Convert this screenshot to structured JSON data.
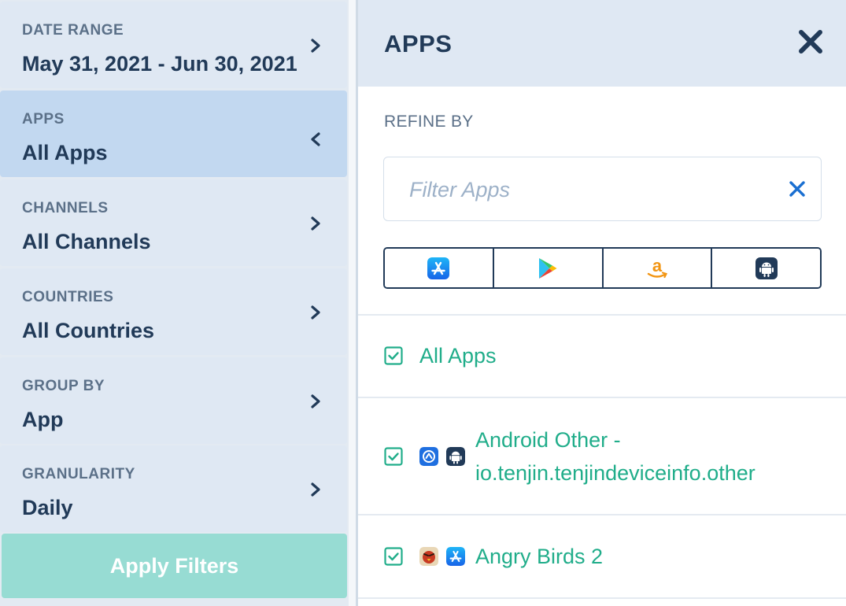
{
  "sidebar": {
    "filters": [
      {
        "label": "DATE RANGE",
        "value": "May 31, 2021 - Jun 30, 2021",
        "active": false
      },
      {
        "label": "APPS",
        "value": "All Apps",
        "active": true
      },
      {
        "label": "CHANNELS",
        "value": "All Channels",
        "active": false
      },
      {
        "label": "COUNTRIES",
        "value": "All Countries",
        "active": false
      },
      {
        "label": "GROUP BY",
        "value": "App",
        "active": false
      },
      {
        "label": "GRANULARITY",
        "value": "Daily",
        "active": false
      }
    ],
    "apply_label": "Apply Filters"
  },
  "panel": {
    "title": "APPS",
    "refine_label": "REFINE BY",
    "filter_placeholder": "Filter Apps",
    "filter_value": "",
    "stores": [
      {
        "name": "app-store",
        "icon": "app-store-icon"
      },
      {
        "name": "google-play",
        "icon": "google-play-icon"
      },
      {
        "name": "amazon",
        "icon": "amazon-icon"
      },
      {
        "name": "android",
        "icon": "android-icon"
      }
    ],
    "apps": [
      {
        "name": "All Apps",
        "checked": true,
        "icons": []
      },
      {
        "name_line1": "Android Other -",
        "name_line2": "io.tenjin.tenjindeviceinfo.other",
        "checked": true,
        "icons": [
          "app-generic-icon",
          "android-icon"
        ]
      },
      {
        "name": "Angry Birds 2",
        "checked": true,
        "icons": [
          "angry-birds-icon",
          "app-store-icon"
        ]
      }
    ]
  },
  "colors": {
    "accent_green": "#20ad8a",
    "navy": "#213a58",
    "sidebar_bg": "#dfe8f3",
    "sidebar_active": "#c2d8f0",
    "apply_bg": "#97dcd3",
    "clear_blue": "#1a6fd1"
  }
}
